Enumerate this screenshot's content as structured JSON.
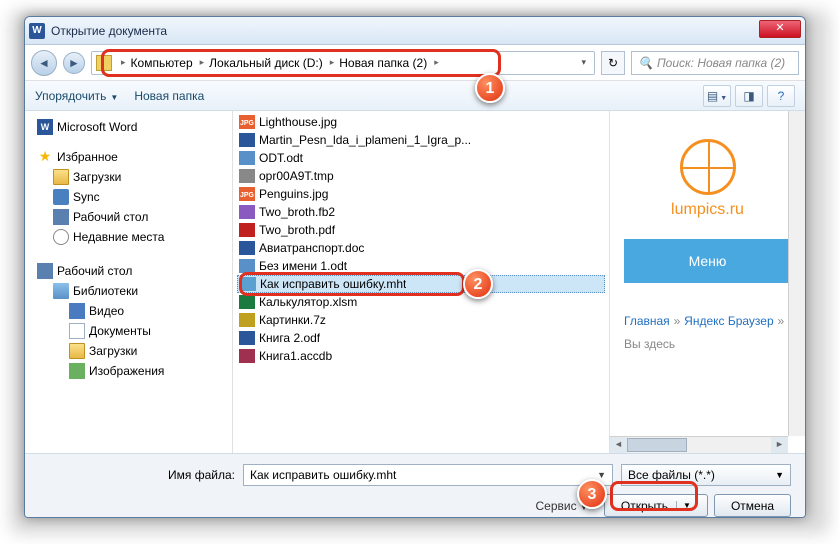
{
  "window": {
    "title": "Открытие документа"
  },
  "nav": {
    "crumbs": [
      "Компьютер",
      "Локальный диск (D:)",
      "Новая папка (2)"
    ],
    "search_placeholder": "Поиск: Новая папка (2)"
  },
  "toolbar": {
    "organize": "Упорядочить",
    "newfolder": "Новая папка"
  },
  "sidebar": {
    "word": "Microsoft Word",
    "fav": "Избранное",
    "fav_items": [
      "Загрузки",
      "Sync",
      "Рабочий стол",
      "Недавние места"
    ],
    "desktop": "Рабочий стол",
    "libs": "Библиотеки",
    "lib_items": [
      "Видео",
      "Документы",
      "Загрузки",
      "Изображения"
    ]
  },
  "files": [
    {
      "ico": "fi-jpg",
      "name": "Lighthouse.jpg"
    },
    {
      "ico": "fi-doc",
      "name": "Martin_Pesn_lda_i_plameni_1_Igra_p..."
    },
    {
      "ico": "fi-odt",
      "name": "ODT.odt"
    },
    {
      "ico": "fi-tmp",
      "name": "opr00A9T.tmp"
    },
    {
      "ico": "fi-jpg",
      "name": "Penguins.jpg"
    },
    {
      "ico": "fi-fb2",
      "name": "Two_broth.fb2"
    },
    {
      "ico": "fi-pdf",
      "name": "Two_broth.pdf"
    },
    {
      "ico": "fi-doc2",
      "name": "Авиатранспорт.doc"
    },
    {
      "ico": "fi-odt",
      "name": "Без имени 1.odt"
    },
    {
      "ico": "fi-mht",
      "name": "Как исправить ошибку.mht",
      "selected": true
    },
    {
      "ico": "fi-xls",
      "name": "Калькулятор.xlsm"
    },
    {
      "ico": "fi-7z",
      "name": "Картинки.7z"
    },
    {
      "ico": "fi-doc2",
      "name": "Книга 2.odf"
    },
    {
      "ico": "fi-db",
      "name": "Книга1.accdb"
    }
  ],
  "preview": {
    "brand": "lumpics.ru",
    "menu": "Меню",
    "link1": "Главная",
    "sep": "»",
    "link2": "Яндекс Браузер",
    "tail": "Вы здесь"
  },
  "footer": {
    "filename_label": "Имя файла:",
    "filename_value": "Как исправить ошибку.mht",
    "filter": "Все файлы (*.*)",
    "tools": "Сервис",
    "open": "Открыть",
    "cancel": "Отмена"
  },
  "markers": {
    "m1": "1",
    "m2": "2",
    "m3": "3"
  }
}
